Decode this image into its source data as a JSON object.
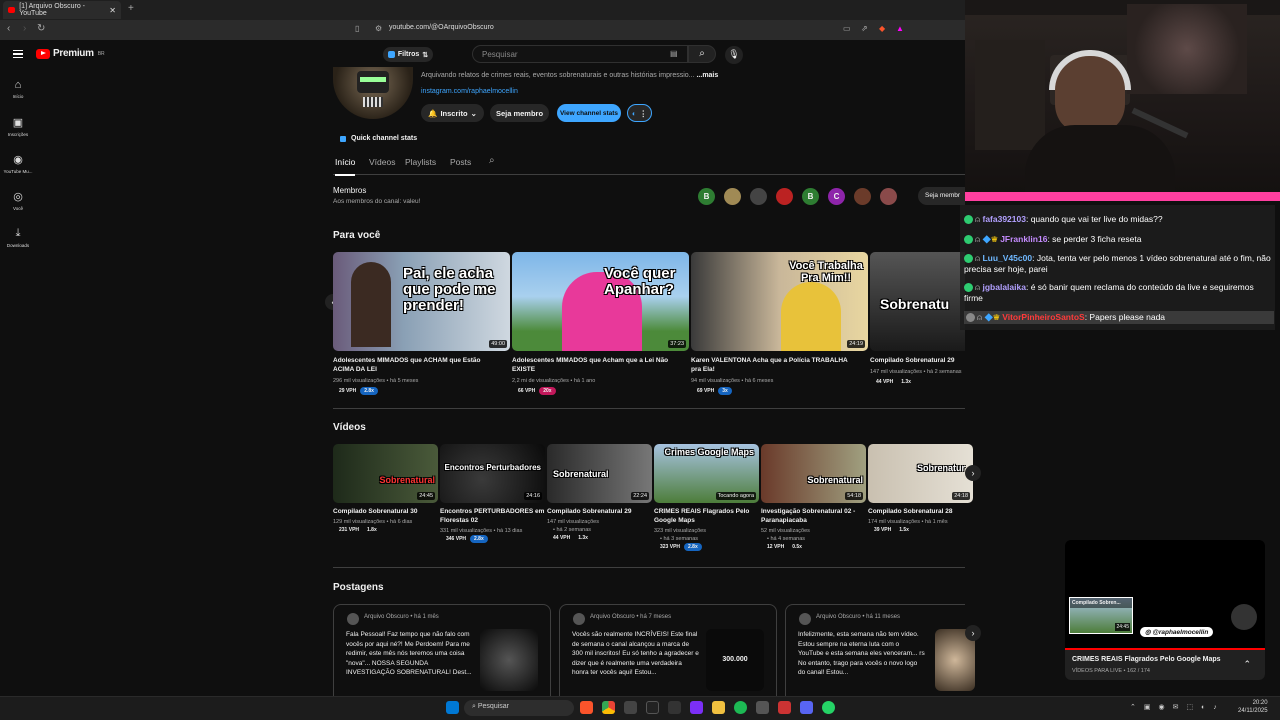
{
  "browser": {
    "tab_title": "[1] Arquivo Obscuro - YouTube",
    "url": "youtube.com/@OArquivoObscuro"
  },
  "header": {
    "logo_text": "Premium",
    "logo_region": "BR",
    "filter_label": "Filtros",
    "search_placeholder": "Pesquisar"
  },
  "sidebar": {
    "items": [
      {
        "label": "Início",
        "icon": "home-icon"
      },
      {
        "label": "Inscrições",
        "icon": "subscriptions-icon"
      },
      {
        "label": "YouTube Mu...",
        "icon": "music-icon"
      },
      {
        "label": "Você",
        "icon": "user-icon"
      },
      {
        "label": "Downloads",
        "icon": "download-icon"
      }
    ]
  },
  "channel": {
    "description": "Arquivando relatos de crimes reais, eventos sobrenaturais e outras histórias impressio...",
    "more": "...mais",
    "link": "instagram.com/raphaelmocellin",
    "subscribed_label": "Inscrito",
    "member_label": "Seja membro",
    "stats_label": "View channel stats",
    "quick_stats": "Quick channel stats"
  },
  "channel_tabs": [
    "Início",
    "Vídeos",
    "Playlists",
    "Posts"
  ],
  "members": {
    "title": "Membros",
    "subtitle": "Aos membros do canal: valeu!",
    "join_label": "Seja membr",
    "avatars": [
      "B",
      "",
      "",
      "",
      "B",
      "C",
      "",
      ""
    ]
  },
  "para_voce": {
    "title": "Para você",
    "videos": [
      {
        "overlay": "Pai, ele acha que pode me prender!",
        "duration": "49:00",
        "title": "Adolescentes MIMADOS que ACHAM que Estão ACIMA DA LEI",
        "meta": "296 mil visualizações • há 5 meses",
        "vph": "29 VPH",
        "mult": "2.8x"
      },
      {
        "overlay": "Você quer Apanhar?",
        "duration": "37:23",
        "title": "Adolescentes MIMADOS que Acham que a Lei Não EXISTE",
        "meta": "2,2 mi de visualizações • há 1 ano",
        "vph": "66 VPH",
        "mult": "20x"
      },
      {
        "overlay": "Você Trabalha Pra Mim!!",
        "duration": "24:19",
        "title": "Karen VALENTONA Acha que a Polícia TRABALHA pra Ela!",
        "meta": "94 mil visualizações • há 6 meses",
        "vph": "69 VPH",
        "mult": "3x"
      },
      {
        "overlay": "Sobrenatu",
        "duration": "",
        "title": "Compilado Sobrenatural 29",
        "meta": "147 mil visualizações • há 2 semanas",
        "vph": "44 VPH",
        "mult": "1.3x"
      }
    ]
  },
  "videos_section": {
    "title": "Vídeos",
    "videos": [
      {
        "overlay": "Sobrenatural",
        "duration": "24:45",
        "title": "Compilado Sobrenatural 30",
        "meta1": "129 mil visualizações • há 6 dias",
        "meta2": "",
        "vph": "231 VPH",
        "mult": "1.8x"
      },
      {
        "overlay": "Encontros Perturbadores",
        "duration": "24:16",
        "title": "Encontros PERTURBADORES em Florestas 02",
        "meta1": "331 mil visualizações • há 13 dias",
        "meta2": "",
        "vph": "346 VPH",
        "mult": "2.8x"
      },
      {
        "overlay": "Sobrenatural",
        "duration": "22:24",
        "title": "Compilado Sobrenatural 29",
        "meta1": "147 mil visualizações",
        "meta2": "• há 2 semanas",
        "vph": "44 VPH",
        "mult": "1.3x"
      },
      {
        "overlay": "Crimes Google Maps",
        "duration": "Tocando agora",
        "title": "CRIMES REAIS Flagrados Pelo Google Maps",
        "meta1": "323 mil visualizações",
        "meta2": "• há 3 semanas",
        "vph": "323 VPH",
        "mult": "2.8x"
      },
      {
        "overlay": "Sobrenatural",
        "duration": "54:18",
        "title": "Investigação Sobrenatural 02 - Paranapiacaba",
        "meta1": "52 mil visualizações",
        "meta2": "• há 4 semanas",
        "vph": "12 VPH",
        "mult": "0.5x"
      },
      {
        "overlay": "Sobrenatur",
        "duration": "24:18",
        "title": "Compilado Sobrenatural 28",
        "meta1": "174 mil visualizações • há 1 mês",
        "meta2": "",
        "vph": "39 VPH",
        "mult": "1.5x"
      }
    ]
  },
  "postagens": {
    "title": "Postagens",
    "posts": [
      {
        "author": "Arquivo Obscuro • há 1 mês",
        "text": "Fala Pessoal! Faz tempo que não falo com vocês por aqui né?! Me Perdoem! Para me redimir, este mês nós teremos uma coisa \"nova\"... NOSSA SEGUNDA INVESTIGAÇÃO SOBRENATURAL! Dest...",
        "img_text": ""
      },
      {
        "author": "Arquivo Obscuro • há 7 meses",
        "text": "Vocês são realmente INCRÍVEIS! Este final de semana o canal alcançou a marca de 300 mil inscritos! Eu só tenho a agradecer e dizer que é realmente uma verdadeira honra ter vocês aqui! Estou...",
        "img_text": "300.000"
      },
      {
        "author": "Arquivo Obscuro • há 11 meses",
        "text": "Infelizmente, esta semana não tem vídeo. Estou sempre na eterna luta com o YouTube e esta semana eles venceram... rs No entanto, trago para vocês o novo logo do canal! Estou...",
        "img_text": ""
      }
    ]
  },
  "chat": {
    "messages": [
      {
        "user": "fafa392103",
        "text": "quando que vai ter live do midas??",
        "color": "#b2a0ff"
      },
      {
        "user": "JFranklin16",
        "text": "se perder 3 ficha reseta",
        "color": "#c58cff"
      },
      {
        "user": "Luu_V45c00",
        "text": "Jota, tenta ver pelo menos 1 vídeo sobrenatural até o fim, não precisa ser hoje, parei",
        "color": "#6fb8ff"
      },
      {
        "user": "jgbalalaika",
        "text": "é só banir quem reclama do conteúdo da live e seguiremos firme",
        "color": "#b2a0ff"
      },
      {
        "user": "VitorPinheiroSantoS",
        "text": "Papers please nada",
        "color": "#ff3a3a"
      }
    ]
  },
  "miniplayer": {
    "thumb_label": "Compilado Sobren...",
    "thumb_duration": "24:45",
    "handle": "@raphaelmocellin",
    "title": "CRIMES REAIS Flagrados Pelo Google Maps",
    "subtitle": "VÍDEOS PARA LIVE • 162 / 174"
  },
  "taskbar": {
    "search_label": "Pesquisar",
    "time": "20:20",
    "date": "24/11/2025"
  },
  "colors": {
    "accent_blue": "#3ea6ff",
    "youtube_red": "#ff0000",
    "overlay_pink": "#ff3fa0"
  }
}
